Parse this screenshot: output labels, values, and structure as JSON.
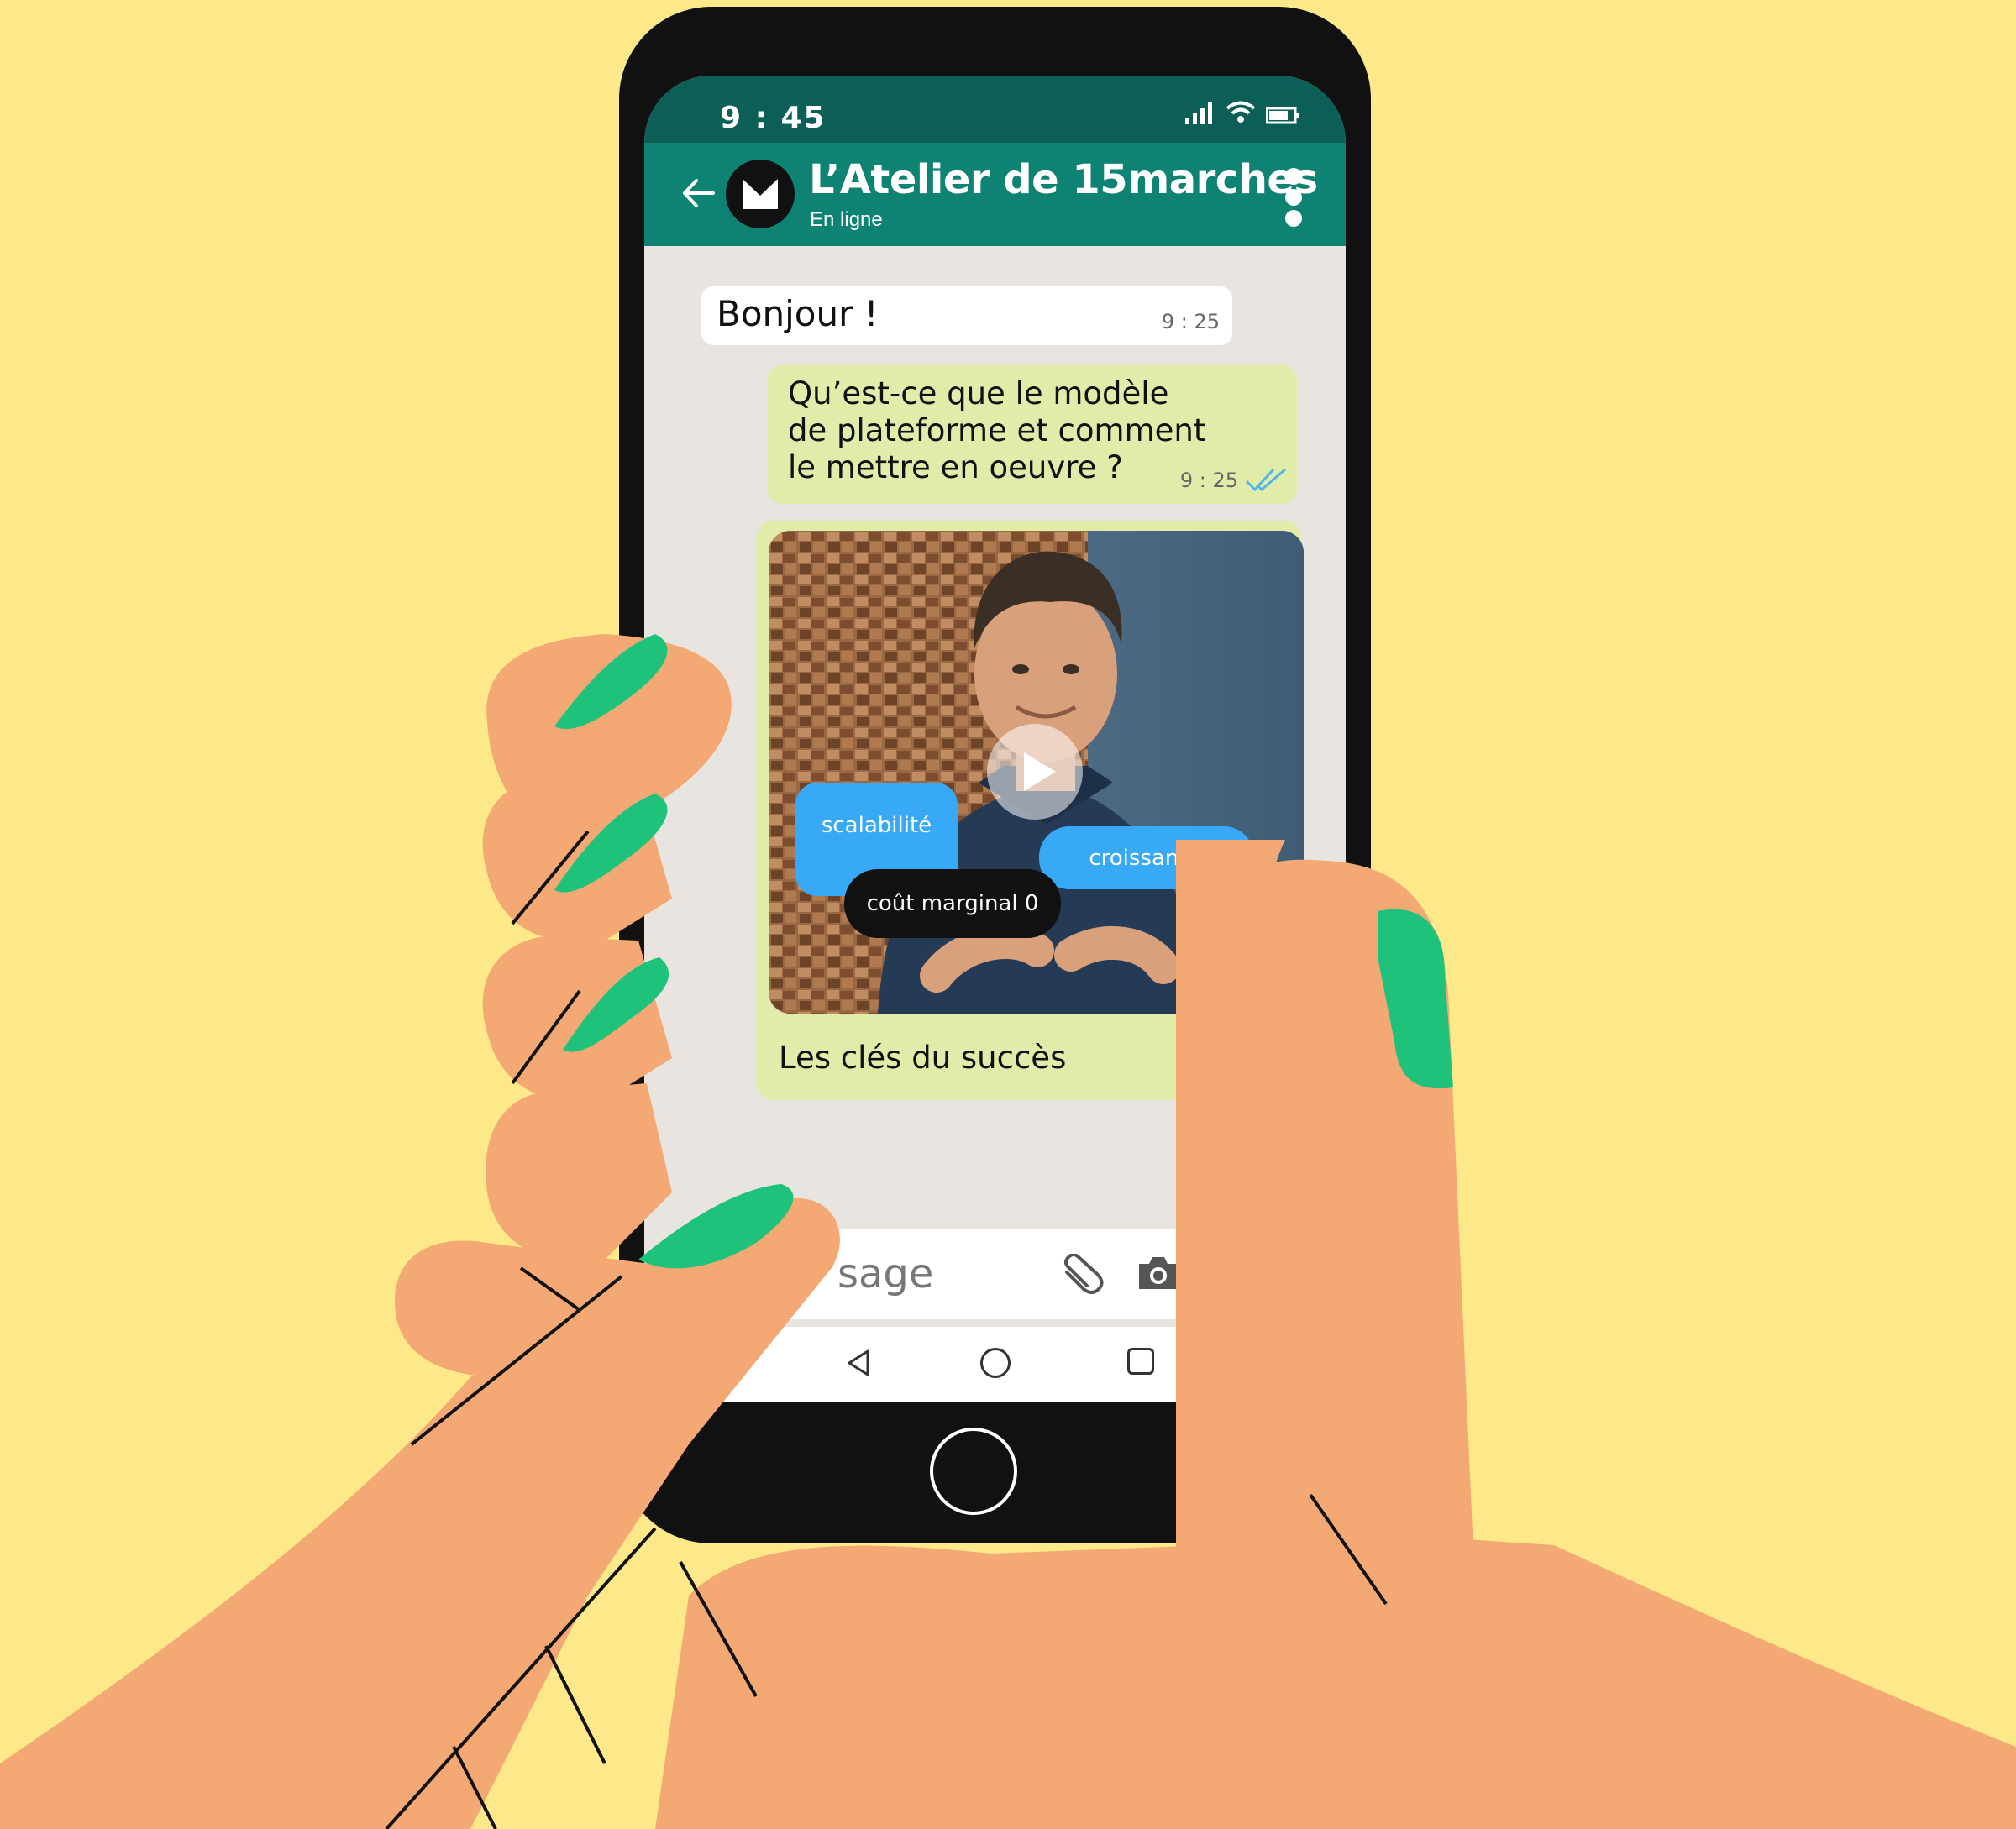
{
  "status_bar": {
    "time": "9 : 45"
  },
  "header": {
    "title": "L’Atelier de 15marches",
    "subtitle": "En ligne",
    "avatar_letter": "M"
  },
  "messages": {
    "incoming": {
      "text": "Bonjour !",
      "time": "9 : 25"
    },
    "outgoing": {
      "text": "Qu’est-ce que le modèle de plateforme et comment le mettre en oeuvre ?",
      "time": "9 : 25",
      "read": true
    },
    "video": {
      "caption": "Les clés du succès",
      "tags": {
        "scalabilite": "scalabilité",
        "croissance": "croissance",
        "cout": "coût marginal 0"
      }
    }
  },
  "input": {
    "placeholder_visible": "sage"
  },
  "colors": {
    "background": "#FDE98A",
    "header": "#0E8273",
    "status_bar": "#0B5F56",
    "outgoing_bubble": "#E2ECAA",
    "tag_blue": "#38A9F6",
    "skin": "#F4A874",
    "nail": "#1FC27A",
    "read_ticks": "#4FB6EC"
  },
  "icons": [
    "back-arrow-icon",
    "more-vert-icon",
    "signal-icon",
    "wifi-icon",
    "battery-icon",
    "play-icon",
    "attach-icon",
    "camera-icon",
    "nav-back-icon",
    "nav-home-icon",
    "nav-recent-icon",
    "double-check-icon"
  ]
}
